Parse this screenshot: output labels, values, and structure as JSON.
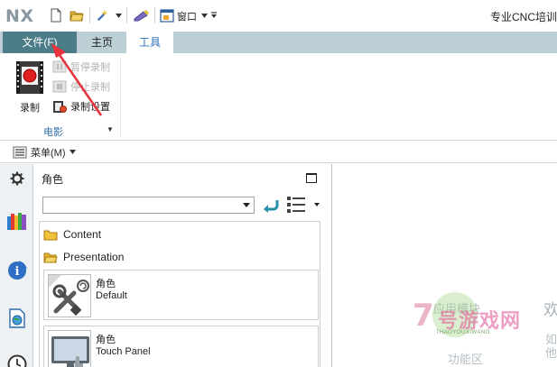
{
  "app": {
    "logo": "NX",
    "title": "专业CNC培训"
  },
  "quick_access": {
    "window_label": "窗口"
  },
  "tabs": [
    {
      "label": "文件(F)",
      "state": "hover"
    },
    {
      "label": "主页",
      "state": "normal"
    },
    {
      "label": "工具",
      "state": "active"
    }
  ],
  "ribbon": {
    "record_label": "录制",
    "pause_label": "暂停录制",
    "stop_label": "停止录制",
    "settings_label": "录制设置",
    "group_label": "电影"
  },
  "menubar": {
    "menu_label": "菜单(M)"
  },
  "resource_bar": {
    "icons": [
      "gear-icon",
      "books-icon",
      "signal-icon",
      "globe-doc-icon",
      "clock-icon"
    ]
  },
  "panel": {
    "title": "角色",
    "select_value": "",
    "folders": [
      "Content",
      "Presentation"
    ],
    "roles": [
      {
        "name": "角色",
        "subtitle": "Default",
        "icon": "tools-icon"
      },
      {
        "name": "角色",
        "subtitle": "Touch Panel",
        "icon": "monitor-icon"
      }
    ]
  },
  "main_area": {
    "ghost_module": "应用模块",
    "ghost_function": "功能区",
    "ghost_welcome": "欢",
    "ghost_line1": "如",
    "ghost_line2": "他"
  },
  "watermark": {
    "digit": "7",
    "text": "号游戏网",
    "small": "7HAOYOUXIWANG"
  },
  "colors": {
    "file_tab_bg": "#4a7d87",
    "tabbar_bg": "#bccfd4",
    "active_tab_text": "#2f73b8",
    "annotation_arrow": "#e8323c"
  }
}
